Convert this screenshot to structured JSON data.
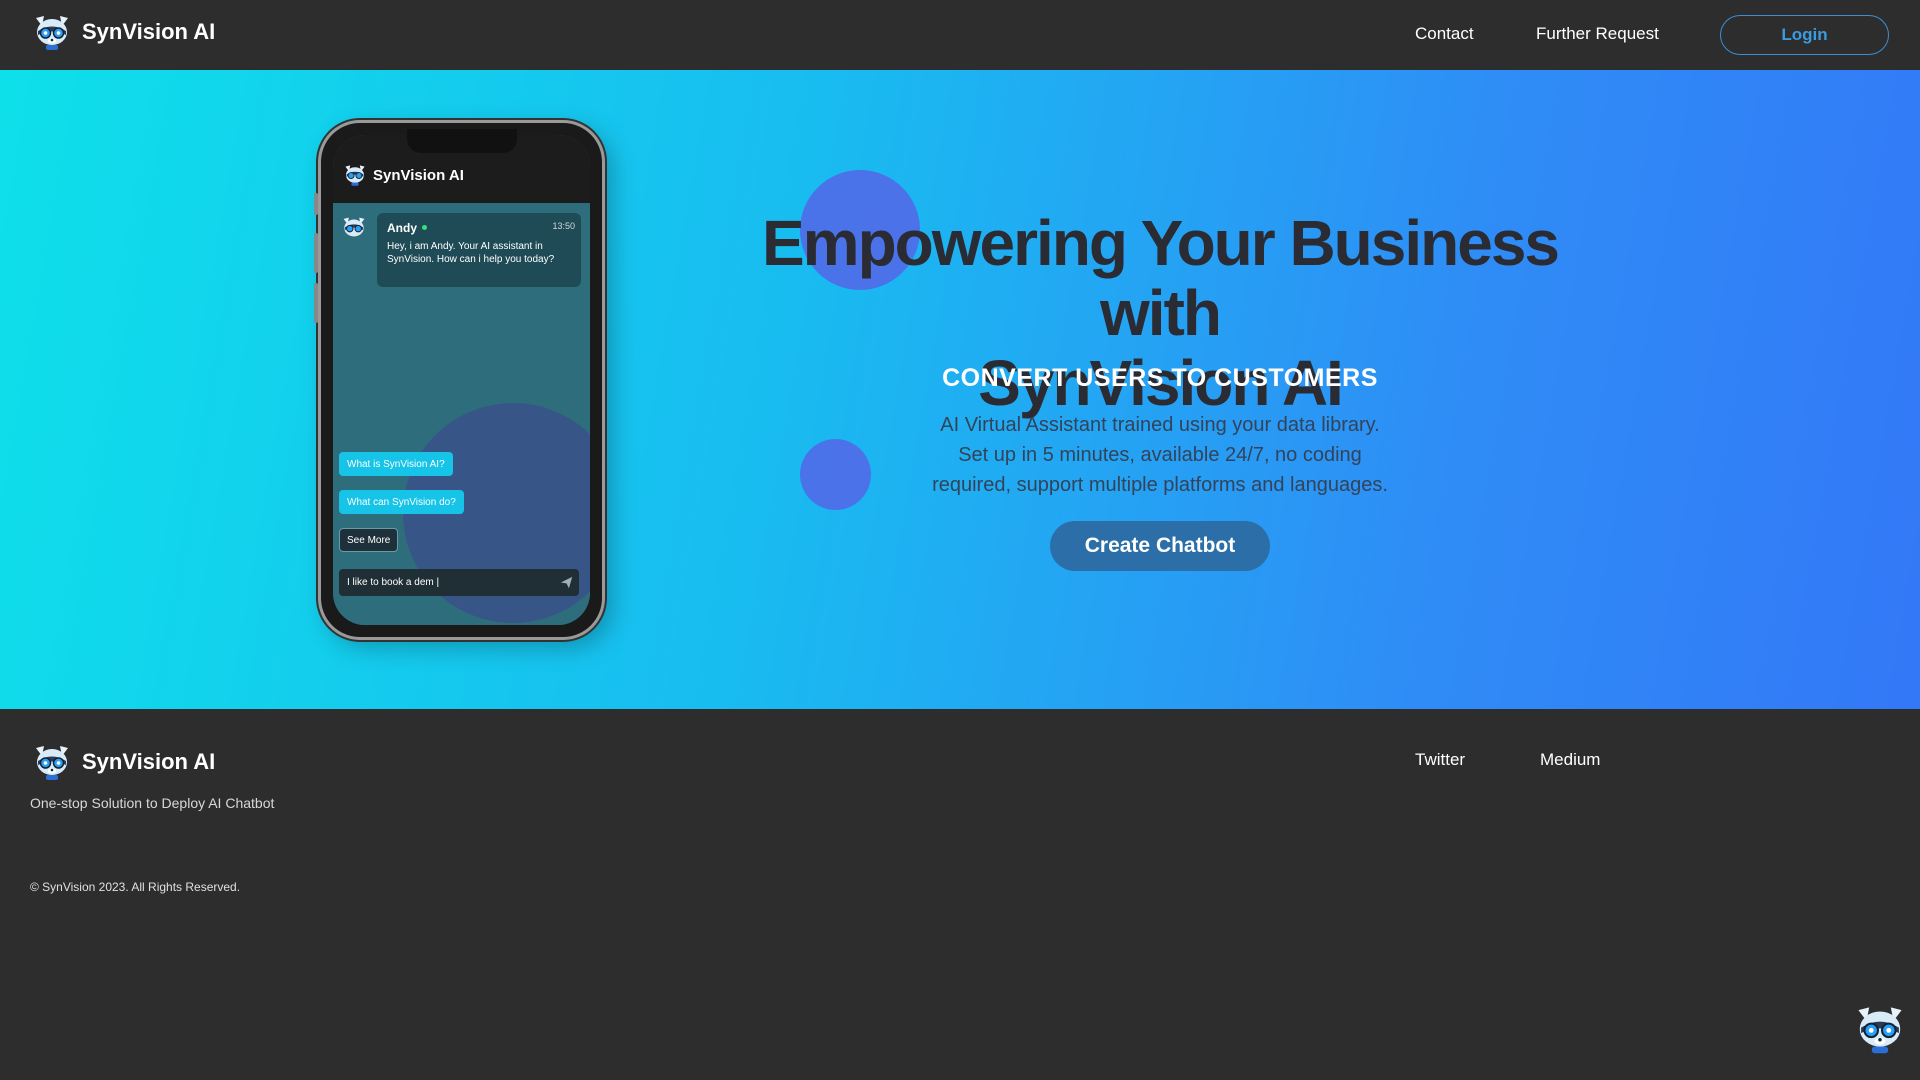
{
  "header": {
    "brand": "SynVision AI",
    "nav": {
      "contact": "Contact",
      "further_request": "Further Request"
    },
    "login_label": "Login"
  },
  "hero": {
    "title_line1": "Empowering Your Business with",
    "title_line2": "SynVision AI",
    "subtitle": "CONVERT USERS TO CUSTOMERS",
    "desc_line1": "AI Virtual Assistant trained using your data library.",
    "desc_line2": "Set up in 5 minutes, available 24/7, no coding",
    "desc_line3": "required, support multiple platforms and languages.",
    "cta_label": "Create Chatbot"
  },
  "phone": {
    "brand": "SynVision AI",
    "message": {
      "sender": "Andy",
      "time": "13:50",
      "text": "Hey, i am Andy. Your AI assistant in SynVision. How can i help you today?"
    },
    "suggestions": [
      "What is SynVision AI?",
      "What can SynVision do?"
    ],
    "see_more": "See More",
    "input_value": "I like to book a dem |"
  },
  "footer": {
    "brand": "SynVision AI",
    "tagline": "One-stop Solution to Deploy AI Chatbot",
    "copyright": "© SynVision 2023. All Rights Reserved.",
    "links": {
      "twitter": "Twitter",
      "medium": "Medium"
    }
  },
  "colors": {
    "nav_bg": "#2d2d2d",
    "hero_gradient_start": "#0ee0ea",
    "hero_gradient_end": "#3378f7",
    "cta_bg": "#2c6fa8",
    "login_accent": "#3a9be0",
    "suggestion_bg": "#16c4e8"
  },
  "icons": {
    "brand_logo": "raccoon-mascot-icon",
    "send": "send-icon",
    "chat_widget": "raccoon-mascot-icon"
  }
}
